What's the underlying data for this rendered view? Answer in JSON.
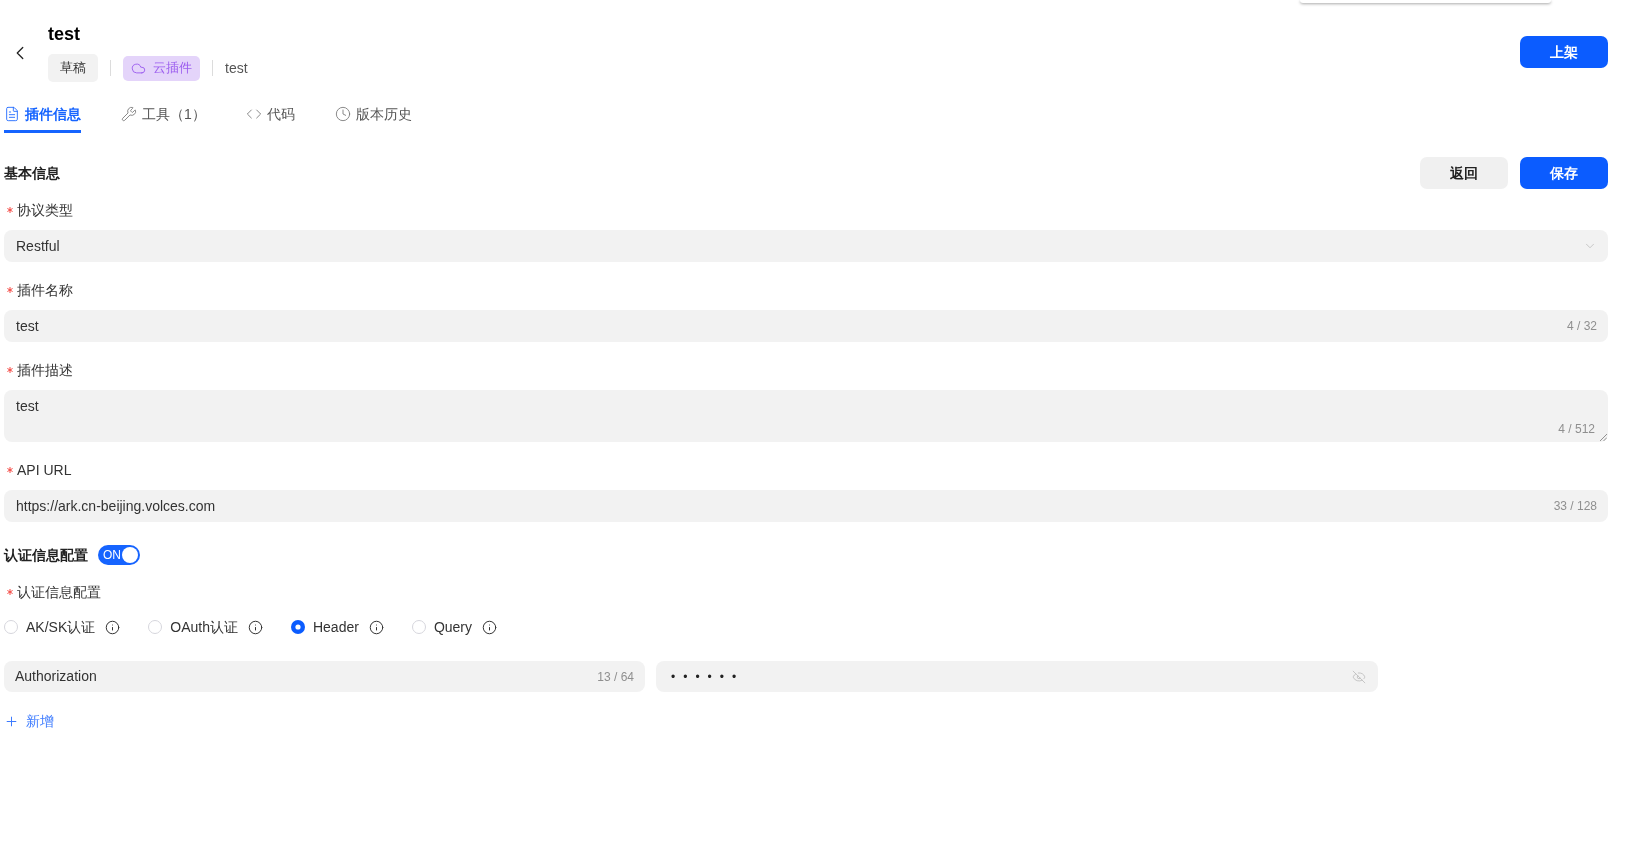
{
  "header": {
    "title": "test",
    "status_tag": "草稿",
    "type_tag": "云插件",
    "subtitle": "test",
    "publish_button": "上架"
  },
  "tabs": [
    {
      "label": "插件信息",
      "selected": true
    },
    {
      "label": "工具（1）",
      "selected": false
    },
    {
      "label": "代码",
      "selected": false
    },
    {
      "label": "版本历史",
      "selected": false
    }
  ],
  "basic_info": {
    "title": "基本信息",
    "buttons": [
      {
        "label": "返回",
        "kind": "secondary"
      },
      {
        "label": "保存",
        "kind": "primary"
      }
    ],
    "fields": [
      {
        "kind": "select",
        "label": "协议类型",
        "required": true,
        "value": "Restful"
      },
      {
        "kind": "input",
        "label": "插件名称",
        "required": true,
        "value": "test",
        "counter": "4 / 32"
      },
      {
        "kind": "textarea",
        "label": "插件描述",
        "required": true,
        "value": "test",
        "counter": "4 / 512"
      },
      {
        "kind": "input",
        "label": "API URL",
        "required": true,
        "value": "https://ark.cn-beijing.volces.com",
        "counter": "33 / 128"
      }
    ]
  },
  "auth": {
    "title": "认证信息配置",
    "toggle": {
      "on": true,
      "text": "ON"
    },
    "label": "认证信息配置",
    "required": true,
    "options": [
      {
        "label": "AK/SK认证",
        "selected": false
      },
      {
        "label": "OAuth认证",
        "selected": false
      },
      {
        "label": "Header",
        "selected": true
      },
      {
        "label": "Query",
        "selected": false
      }
    ],
    "params": [
      {
        "key": "Authorization",
        "key_counter": "13 / 64",
        "value": "••••••"
      }
    ],
    "add_button": "新增"
  }
}
